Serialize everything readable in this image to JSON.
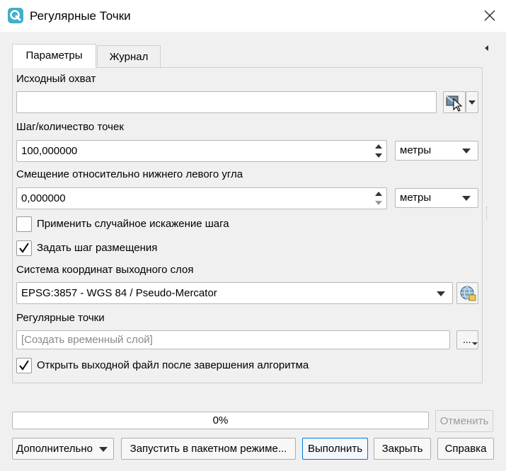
{
  "window": {
    "title": "Регулярные Точки",
    "app_icon": "qgis-icon",
    "close_icon": "close-icon"
  },
  "tabs": [
    {
      "label": "Параметры",
      "active": true
    },
    {
      "label": "Журнал",
      "active": false
    }
  ],
  "params": {
    "extent": {
      "label": "Исходный охват",
      "value": ""
    },
    "spacing": {
      "label": "Шаг/количество точек",
      "value": "100,000000",
      "unit": "метры"
    },
    "offset": {
      "label": "Смещение относительно нижнего левого угла",
      "value": "0,000000",
      "unit": "метры"
    },
    "randomize": {
      "label": "Применить случайное искажение шага",
      "checked": false
    },
    "use_spacing": {
      "label": "Задать шаг размещения",
      "checked": true
    },
    "crs": {
      "label": "Система координат выходного слоя",
      "value": "EPSG:3857 - WGS 84 / Pseudo-Mercator"
    },
    "output": {
      "label": "Регулярные точки",
      "placeholder": "[Создать временный слой]",
      "browse_label": "..."
    },
    "open_output": {
      "label": "Открыть выходной файл после завершения алгоритма",
      "checked": true
    }
  },
  "progress": {
    "text": "0%",
    "value": 0
  },
  "buttons": {
    "cancel": "Отменить",
    "advanced": "Дополнительно",
    "batch": "Запустить в пакетном режиме...",
    "run": "Выполнить",
    "close": "Закрыть",
    "help": "Справка"
  },
  "colors": {
    "accent": "#0078d7",
    "app_icon": "#3fb0c9"
  }
}
